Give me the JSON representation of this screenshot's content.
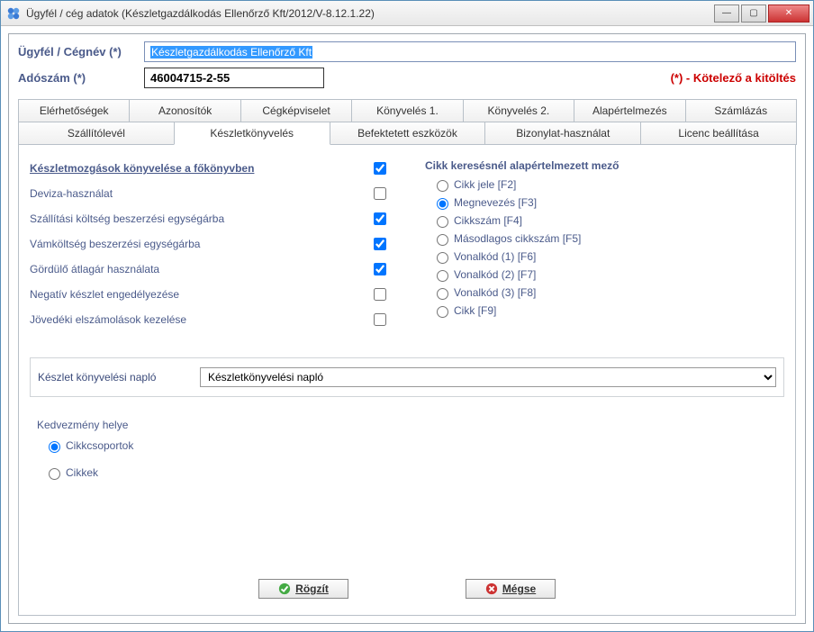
{
  "window": {
    "title": "Ügyfél / cég adatok (Készletgazdálkodás Ellenőrző Kft/2012/V-8.12.1.22)"
  },
  "header": {
    "name_label": "Ügyfél / Cégnév (*)",
    "name_value": "Készletgazdálkodás Ellenőrző Kft",
    "tax_label": "Adószám (*)",
    "tax_value": "46004715-2-55",
    "mandatory_note": "(*) - Kötelező a kitöltés"
  },
  "tabs_row1": [
    "Elérhetőségek",
    "Azonosítók",
    "Cégképviselet",
    "Könyvelés 1.",
    "Könyvelés 2.",
    "Alapértelmezés",
    "Számlázás"
  ],
  "tabs_row2": [
    "Szállítólevél",
    "Készletkönyvelés",
    "Befektetett eszközök",
    "Bizonylat-használat",
    "Licenc beállítása"
  ],
  "active_tab": "Készletkönyvelés",
  "checks": [
    {
      "label": "Készletmozgások könyvelése a főkönyvben",
      "checked": true,
      "first": true
    },
    {
      "label": "Deviza-használat",
      "checked": false
    },
    {
      "label": "Szállítási költség beszerzési egységárba",
      "checked": true
    },
    {
      "label": "Vámköltség beszerzési egységárba",
      "checked": true
    },
    {
      "label": "Gördülő átlagár használata",
      "checked": true
    },
    {
      "label": "Negatív készlet engedélyezése",
      "checked": false
    },
    {
      "label": "Jövedéki elszámolások kezelése",
      "checked": false
    }
  ],
  "search_group": {
    "title": "Cikk keresésnél alapértelmezett mező",
    "options": [
      "Cikk jele [F2]",
      "Megnevezés [F3]",
      "Cikkszám [F4]",
      "Másodlagos cikkszám [F5]",
      "Vonalkód (1) [F6]",
      "Vonalkód (2) [F7]",
      "Vonalkód (3) [F8]",
      "Cikk [F9]"
    ],
    "selected": 1
  },
  "journal": {
    "label": "Készlet könyvelési napló",
    "value": "Készletkönyvelési napló"
  },
  "discount": {
    "title": "Kedvezmény helye",
    "options": [
      "Cikkcsoportok",
      "Cikkek"
    ],
    "selected": 0
  },
  "buttons": {
    "save": "Rögzít",
    "cancel": "Mégse"
  }
}
